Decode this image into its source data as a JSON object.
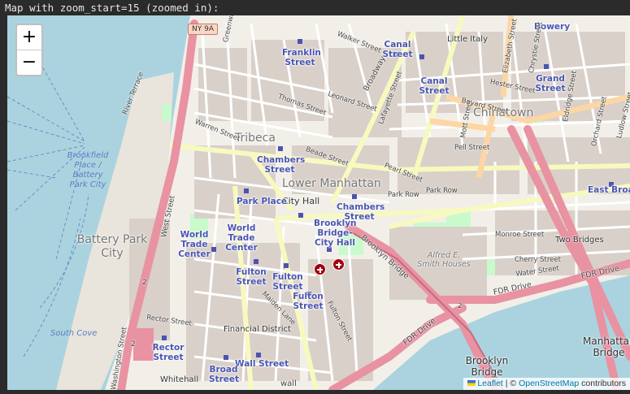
{
  "caption": "Map with zoom_start=15 (zoomed in):",
  "zoom_controls": {
    "zoom_in": "+",
    "zoom_out": "−"
  },
  "attribution": {
    "leaflet": "Leaflet",
    "separator": " | © ",
    "osm": "OpenStreetMap",
    "contributors": " contributors"
  },
  "route_shields": {
    "ny9a": "NY 9A",
    "route2_a": "2",
    "route2_b": "2",
    "route2_c": "2"
  },
  "areas": {
    "tribeca": "Tribeca",
    "lower_manhattan": "Lower Manhattan",
    "chinatown": "Chinatown",
    "battery_park_city": "Battery Park City",
    "financial_district": "Financial District",
    "two_bridges": "Two Bridges",
    "little_italy": "Little Italy",
    "city_hall": "City Hall",
    "alfred_smith": "Alfred E. Smith Houses",
    "whitehall": "Whitehall"
  },
  "stations": {
    "franklin": "Franklin Street",
    "canal_1": "Canal Street",
    "canal_2": "Canal Street",
    "bowery": "Bowery",
    "grand": "Grand Street",
    "chambers_1": "Chambers Street",
    "chambers_2": "Chambers Street",
    "park_place": "Park Place",
    "wtc": "World Trade Center",
    "world_trade": "World Trade Center",
    "brooklyn_bridge_ch": "Brooklyn Bridge-City Hall",
    "fulton_1": "Fulton Street",
    "fulton_2": "Fulton Street",
    "fulton_3": "Fulton Street",
    "rector": "Rector Street",
    "wall": "Wall Street",
    "broad": "Broad Street",
    "east_broadway": "East Broad"
  },
  "water_labels": {
    "brookfield": "Brookfield Place / Battery Park City",
    "south_cove": "South Cove"
  },
  "streets": {
    "greenwich": "Greenwich Street",
    "walker": "Walker Street",
    "broadway": "Broadway",
    "lafayette": "Lafayette Street",
    "leonard": "Leonard Street",
    "thomas": "Thomas Street",
    "warren": "Warren Street",
    "river_terrace": "River Terrace",
    "beade": "Beade Street",
    "pearl": "Pearl Street",
    "park_row": "Park Row",
    "park_row_2": "Park Row",
    "west": "West Street",
    "hester": "Hester Street",
    "elizabeth": "Elizabeth Street",
    "mott": "Mott Street",
    "pell": "Pell Street",
    "bayard": "Bayard Street",
    "chrystie": "Chrystie Street",
    "eldridge": "Eldridge Street",
    "orchard": "Orchard Street",
    "ludlow": "Ludlow Street",
    "monroe": "Monroe Street",
    "cherry": "Cherry Street",
    "water": "Water Street",
    "fdr_1": "FDR Drive",
    "fdr_2": "FDR Drive",
    "fdr_3": "FDR Drive",
    "brooklyn_bridge_rd": "Brooklyn Bridge",
    "rector_st": "Rector Street",
    "washington": "Washington Street",
    "maiden": "Maiden Lane",
    "fulton_st": "Fulton Street",
    "wall_st": "wall"
  },
  "bridges": {
    "brooklyn": "Brooklyn Bridge",
    "manhattan": "Manhattan Bridge"
  },
  "markers": [
    "medical-marker",
    "medical-marker"
  ],
  "colors": {
    "land": "#f2efe9",
    "water": "#aad3df",
    "motorway": "#e892a2",
    "primary": "#fcd6a4",
    "secondary": "#f7fabf",
    "residential": "#ffffff",
    "park": "#c8facc",
    "station": "#4a55b0",
    "marker": "#a0000f"
  }
}
